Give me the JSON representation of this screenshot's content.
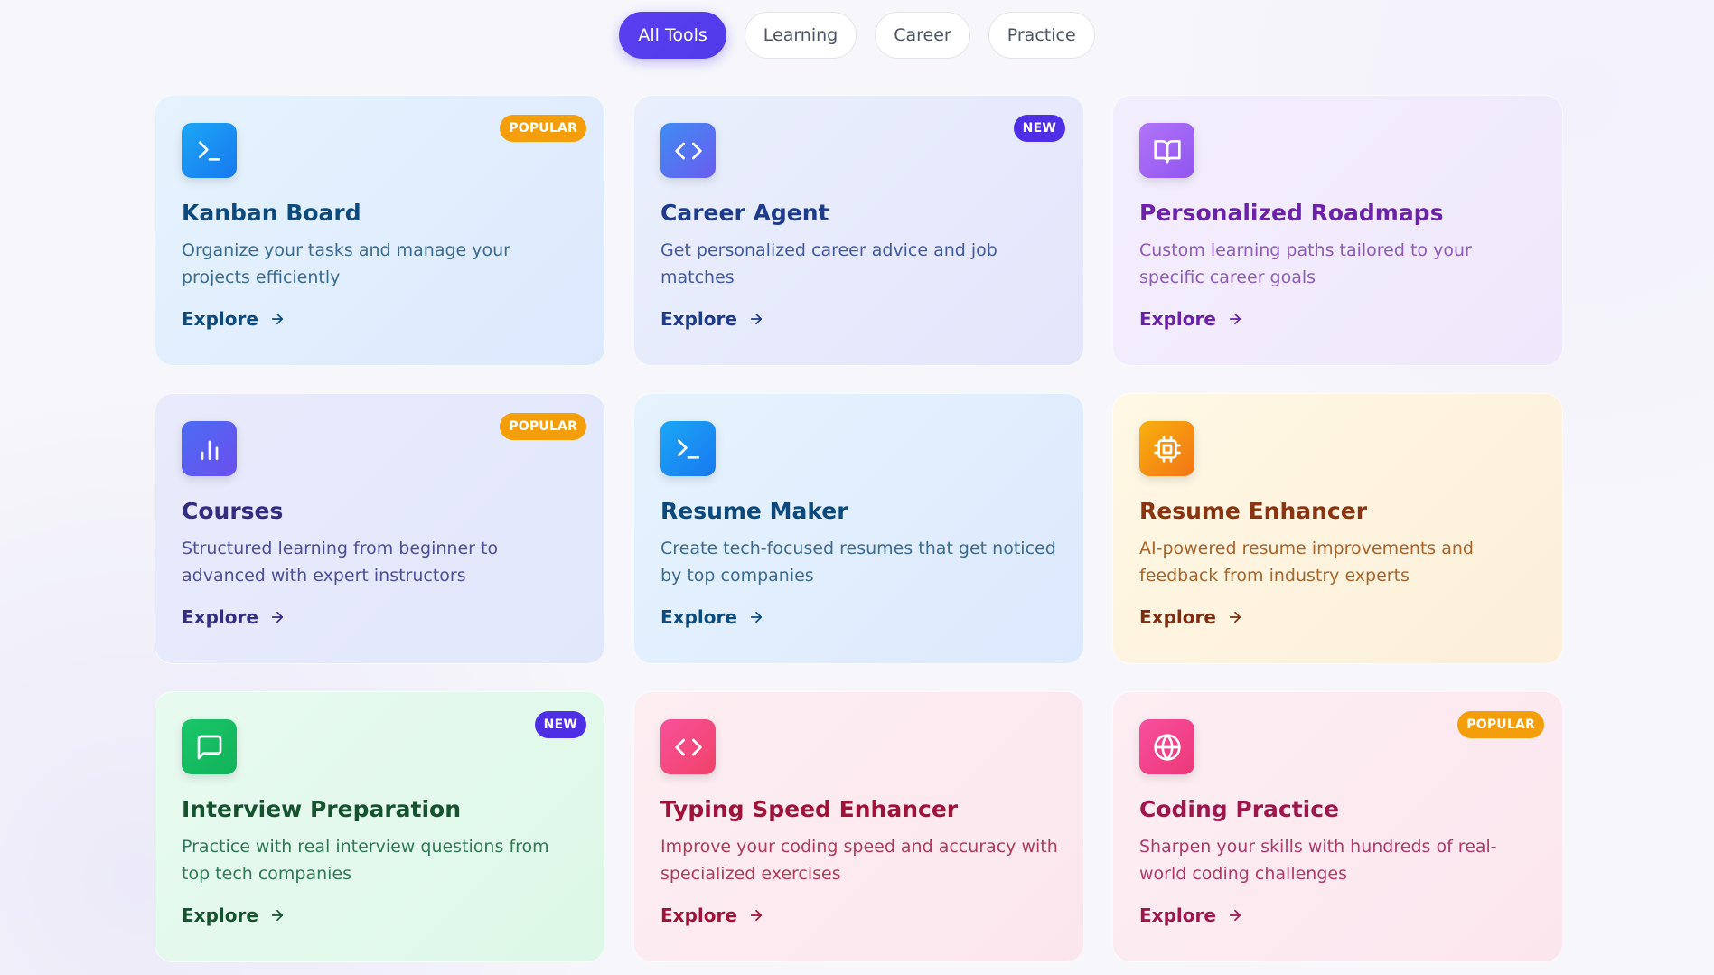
{
  "filters": [
    {
      "label": "All Tools",
      "active": true
    },
    {
      "label": "Learning",
      "active": false
    },
    {
      "label": "Career",
      "active": false
    },
    {
      "label": "Practice",
      "active": false
    }
  ],
  "cards": [
    {
      "title": "Kanban Board",
      "description": "Organize your tasks and manage your projects efficiently",
      "cta": "Explore",
      "badge": "POPULAR",
      "icon": "terminal-icon",
      "theme": "sky"
    },
    {
      "title": "Career Agent",
      "description": "Get personalized career advice and job matches",
      "cta": "Explore",
      "badge": "NEW",
      "icon": "code-icon",
      "theme": "indigo"
    },
    {
      "title": "Personalized Roadmaps",
      "description": "Custom learning paths tailored to your specific career goals",
      "cta": "Explore",
      "badge": "",
      "icon": "book-icon",
      "theme": "purple"
    },
    {
      "title": "Courses",
      "description": "Structured learning from beginner to advanced with expert instructors",
      "cta": "Explore",
      "badge": "POPULAR",
      "icon": "bar-chart-icon",
      "theme": "violet"
    },
    {
      "title": "Resume Maker",
      "description": "Create tech-focused resumes that get noticed by top companies",
      "cta": "Explore",
      "badge": "",
      "icon": "terminal-icon",
      "theme": "sky"
    },
    {
      "title": "Resume Enhancer",
      "description": "AI-powered resume improvements and feedback from industry experts",
      "cta": "Explore",
      "badge": "",
      "icon": "cpu-icon",
      "theme": "amber"
    },
    {
      "title": "Interview Preparation",
      "description": "Practice with real interview questions from top tech companies",
      "cta": "Explore",
      "badge": "NEW",
      "icon": "message-icon",
      "theme": "green"
    },
    {
      "title": "Typing Speed Enhancer",
      "description": "Improve your coding speed and accuracy with specialized exercises",
      "cta": "Explore",
      "badge": "",
      "icon": "code-icon",
      "theme": "rose"
    },
    {
      "title": "Coding Practice",
      "description": "Sharpen your skills with hundreds of real-world coding challenges",
      "cta": "Explore",
      "badge": "POPULAR",
      "icon": "globe-icon",
      "theme": "pink"
    }
  ],
  "themes": {
    "sky": {
      "bg": "linear-gradient(135deg,#e5f3fe,#dde9fd)",
      "iconBg": "linear-gradient(135deg,#1aa7f5,#1978f0)",
      "title": "#0c4a7e",
      "desc": "#3b6a91",
      "cta": "#0c4a7e"
    },
    "indigo": {
      "bg": "linear-gradient(135deg,#e9effd,#e4e6fb)",
      "iconBg": "linear-gradient(135deg,#3e8cf2,#6b5cf0)",
      "title": "#1e3a8a",
      "desc": "#3f5aa0",
      "cta": "#1e3a8a"
    },
    "purple": {
      "bg": "linear-gradient(135deg,#f3eefe,#efe8fc)",
      "iconBg": "linear-gradient(135deg,#b174f7,#9155f0)",
      "title": "#6b21a8",
      "desc": "#8f5ab8",
      "cta": "#6b21a8"
    },
    "violet": {
      "bg": "linear-gradient(135deg,#e9ebfc,#e2e7fc)",
      "iconBg": "linear-gradient(135deg,#4b6cf2,#6b4ef0)",
      "title": "#312e81",
      "desc": "#4b4f9a",
      "cta": "#312e81"
    },
    "amber": {
      "bg": "linear-gradient(135deg,#fef8e4,#fdefd9)",
      "iconBg": "linear-gradient(135deg,#f8b10d,#f37316)",
      "title": "#8a3412",
      "desc": "#a8642a",
      "cta": "#7c2d12"
    },
    "green": {
      "bg": "linear-gradient(135deg,#e8faf0,#ddf8e7)",
      "iconBg": "linear-gradient(135deg,#19c76a,#11b15a)",
      "title": "#14532d",
      "desc": "#2f7a53",
      "cta": "#14532d"
    },
    "rose": {
      "bg": "linear-gradient(135deg,#fdeef2,#fce6ee)",
      "iconBg": "linear-gradient(135deg,#f8509a,#f04368)",
      "title": "#9f1239",
      "desc": "#b03a5a",
      "cta": "#9f1239"
    },
    "pink": {
      "bg": "linear-gradient(135deg,#fdeef3,#fce6ee)",
      "iconBg": "linear-gradient(135deg,#f84f9e,#ec3878)",
      "title": "#9d174d",
      "desc": "#b0386a",
      "cta": "#9d174d"
    }
  }
}
